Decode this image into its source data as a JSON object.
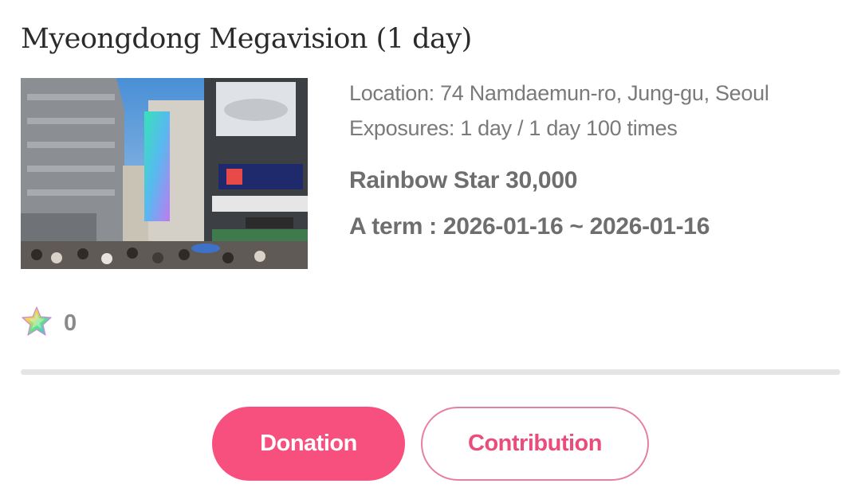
{
  "item": {
    "title": "Myeongdong Megavision (1 day)",
    "image_description_icon": "billboard-photo",
    "location": "Location: 74 Namdaemun-ro, Jung-gu, Seoul",
    "exposures": "Exposures: 1 day / 1 day 100 times",
    "price": "Rainbow Star 30,000",
    "term": "A term : 2026-01-16 ~ 2026-01-16"
  },
  "rating": {
    "icon": "rainbow-star-icon",
    "count": "0"
  },
  "actions": {
    "donation_label": "Donation",
    "contribution_label": "Contribution"
  },
  "colors": {
    "primary_pink": "#f7507f",
    "outline_pink": "#e5809e",
    "text_gray": "#6e6e6e",
    "divider_gray": "#e5e5e5"
  }
}
